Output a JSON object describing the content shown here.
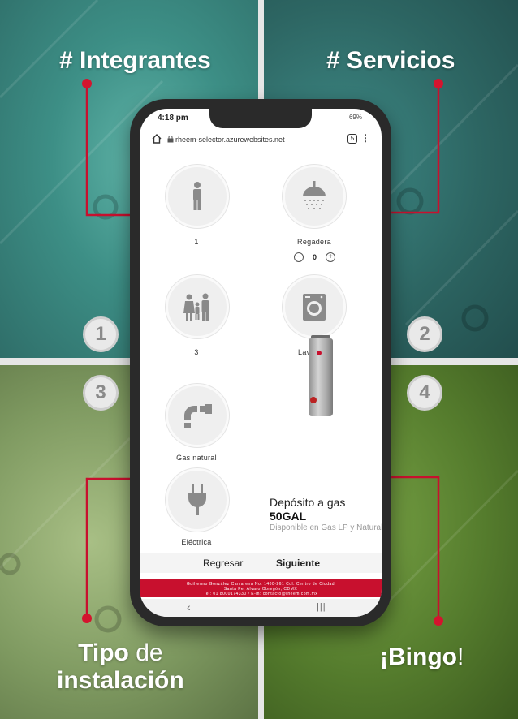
{
  "headings": {
    "q1": "# Integrantes",
    "q2": "# Servicios",
    "q3_bold": "Tipo",
    "q3_light": " de",
    "q3_line2": "instalación",
    "q4_bold": "¡Bingo",
    "q4_light": "!"
  },
  "numbers": {
    "n1": "1",
    "n2": "2",
    "n3": "3",
    "n4": "4"
  },
  "colors": {
    "accent_red": "#c8102e",
    "q1": "#3d8f86",
    "q2": "#2d6663",
    "q3": "#7f9a61",
    "q4": "#557c2d"
  },
  "phone": {
    "status_time": "4:18 pm",
    "status_right": "69%",
    "url": "rheem-selector.azurewebsites.net",
    "tab_count": "5",
    "integrantes": [
      {
        "icon": "single-person-icon",
        "label": "1"
      },
      {
        "icon": "family-icon",
        "label": "3"
      }
    ],
    "servicios": {
      "regadera_icon": "shower-icon",
      "regadera_label": "Regadera",
      "regadera_count": "0",
      "lavadora_icon": "washing-machine-icon",
      "lavadora_label": "Lavadora"
    },
    "instalacion": [
      {
        "icon": "gas-pipe-icon",
        "label": "Gas natural"
      },
      {
        "icon": "electric-plug-icon",
        "label": "Eléctrica"
      }
    ],
    "product": {
      "title": "Depósito a gas",
      "size": "50GAL",
      "desc": "Disponible en Gas LP y Natural"
    },
    "nav": {
      "back": "Regresar",
      "next": "Siguiente"
    },
    "footer_line1": "Guillermo González Camarena No. 1400-261 Col. Centro de Ciudad",
    "footer_line2": "Santa Fe, Alvaro Obregón, CDMX",
    "footer_line3": "Tel: 01 8000174330 / E-m: contacto@rheem.com.mx",
    "sysnav_back": "‹",
    "sysnav_home": "|||"
  }
}
